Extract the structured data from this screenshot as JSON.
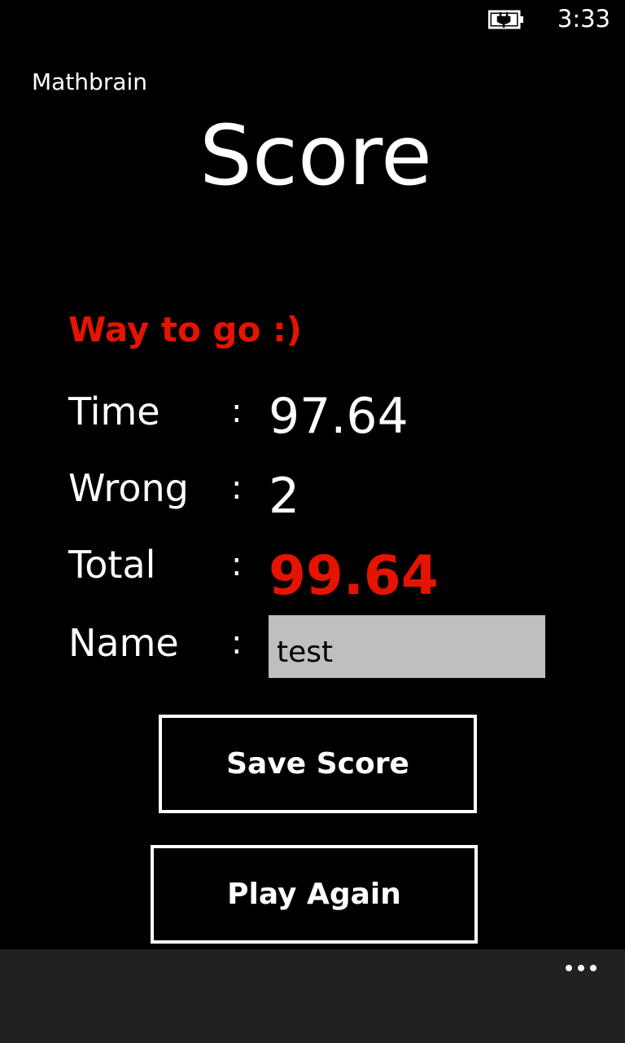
{
  "status_bar": {
    "time": "3:33",
    "battery_icon": "battery-charging-icon"
  },
  "app": {
    "name": "Mathbrain"
  },
  "page": {
    "title": "Score",
    "message": "Way to go :)"
  },
  "results": {
    "separator": ":",
    "time_label": "Time",
    "time_value": "97.64",
    "wrong_label": "Wrong",
    "wrong_value": "2",
    "total_label": "Total",
    "total_value": "99.64",
    "name_label": "Name",
    "name_value": "test"
  },
  "buttons": {
    "save_label": "Save Score",
    "play_again_label": "Play Again"
  },
  "app_bar": {
    "more_icon": "more-ellipsis-icon"
  },
  "colors": {
    "accent": "#e51400",
    "background": "#000000",
    "app_bar": "#212121",
    "input_background": "#bfbfbf"
  }
}
